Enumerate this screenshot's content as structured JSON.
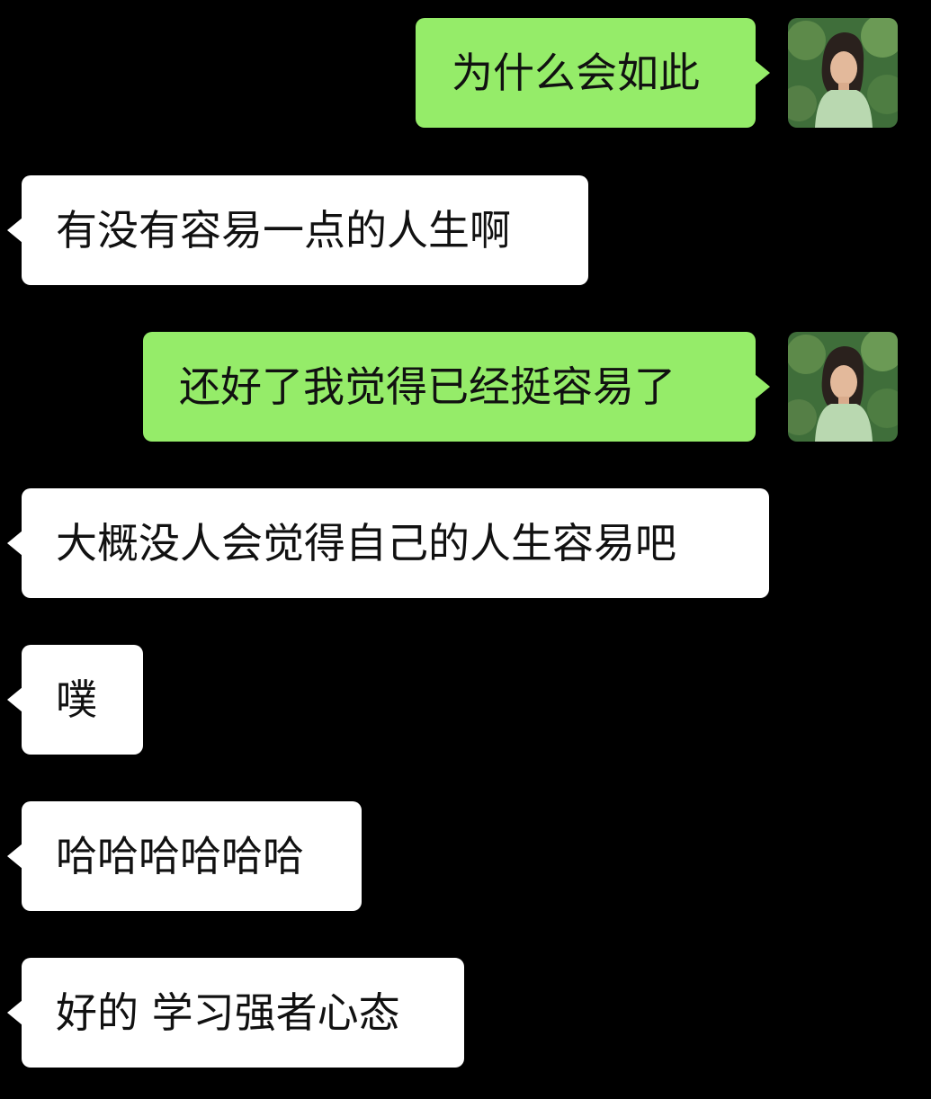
{
  "messages": [
    {
      "direction": "outgoing",
      "text": "为什么会如此"
    },
    {
      "direction": "incoming",
      "text": "有没有容易一点的人生啊"
    },
    {
      "direction": "outgoing",
      "text": "还好了我觉得已经挺容易了"
    },
    {
      "direction": "incoming",
      "text": "大概没人会觉得自己的人生容易吧"
    },
    {
      "direction": "incoming",
      "text": "噗"
    },
    {
      "direction": "incoming",
      "text": "哈哈哈哈哈哈"
    },
    {
      "direction": "incoming",
      "text": "好的 学习强者心态"
    }
  ],
  "colors": {
    "background": "#000000",
    "outgoing_bubble": "#95ec69",
    "incoming_bubble": "#ffffff",
    "text": "#111111"
  },
  "avatar": {
    "icon": "user-avatar-photo"
  }
}
